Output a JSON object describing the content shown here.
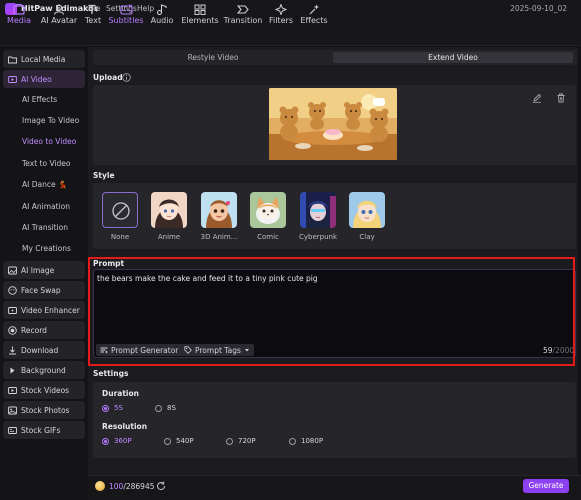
{
  "titlebar": {
    "app_title": "HitPaw Edimakor",
    "menu": [
      "File",
      "Settings",
      "Help"
    ],
    "date": "2025-09-10_02"
  },
  "toolbar": {
    "items": [
      {
        "label": "Media",
        "icon": "media-icon",
        "active": true
      },
      {
        "label": "AI Avatar",
        "icon": "avatar-icon",
        "active": false
      },
      {
        "label": "Text",
        "icon": "text-icon",
        "active": false
      },
      {
        "label": "Subtitles",
        "icon": "subtitles-icon",
        "active": true
      },
      {
        "label": "Audio",
        "icon": "audio-icon",
        "active": false
      },
      {
        "label": "Elements",
        "icon": "elements-icon",
        "active": false
      },
      {
        "label": "Transition",
        "icon": "transition-icon",
        "active": false
      },
      {
        "label": "Filters",
        "icon": "filters-icon",
        "active": false
      },
      {
        "label": "Effects",
        "icon": "effects-icon",
        "active": false
      }
    ]
  },
  "sidebar": {
    "local_media": "Local Media",
    "ai_video": "AI Video",
    "ai_video_subs": [
      "AI Effects",
      "Image To Video",
      "Video to Video",
      "Text to Video",
      "AI Dance 💃",
      "AI Animation",
      "AI Transition",
      "My Creations"
    ],
    "active_sub": "Video to Video",
    "items": [
      "AI Image",
      "Face Swap",
      "Video Enhancer",
      "Record",
      "Download",
      "Background",
      "Stock Videos",
      "Stock Photos",
      "Stock GIFs"
    ]
  },
  "tabs": {
    "restyle": "Restyle Video",
    "extend": "Extend Video",
    "active": "Extend Video"
  },
  "upload": {
    "title": "Upload"
  },
  "style": {
    "title": "Style",
    "options": [
      "None",
      "Anime",
      "3D Anim...",
      "Comic",
      "Cyberpunk",
      "Clay"
    ],
    "selected": "None"
  },
  "prompt": {
    "title": "Prompt",
    "text": "the bears make the cake and feed it to a tiny pink cute pig",
    "generator_label": "Prompt Generator",
    "tags_label": "Prompt Tags",
    "count": "59",
    "max": "/2000"
  },
  "settings": {
    "title": "Settings",
    "duration_label": "Duration",
    "durations": [
      "5S",
      "8S"
    ],
    "duration_selected": "5S",
    "resolution_label": "Resolution",
    "resolutions": [
      "360P",
      "540P",
      "720P",
      "1080P"
    ],
    "resolution_selected": "360P"
  },
  "footer": {
    "credits_current": "100",
    "credits_total": "/286945",
    "generate_label": "Generate"
  },
  "colors": {
    "accent": "#b47cff",
    "highlight": "#e51b1b",
    "generate": "#8d3ff2"
  }
}
